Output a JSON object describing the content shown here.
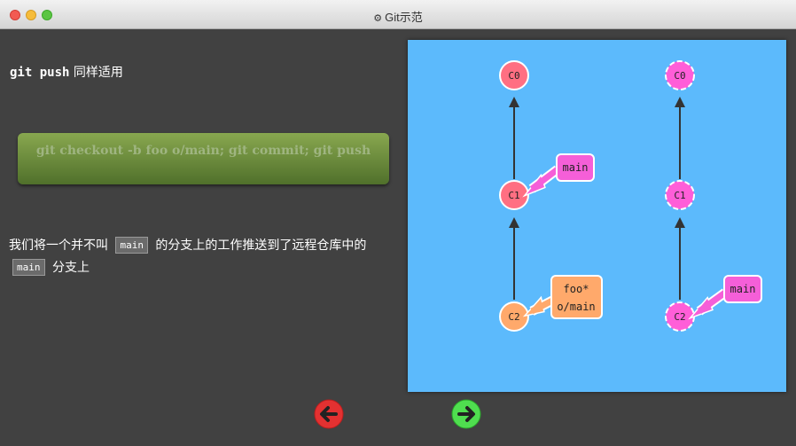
{
  "window": {
    "title": "Git示范",
    "title_icon": "gear-icon"
  },
  "lesson": {
    "heading_code": "git push",
    "heading_text": "同样适用",
    "command": "git checkout -b foo o/main; git commit; git push",
    "desc_part1": "我们将一个并不叫",
    "desc_code1": "main",
    "desc_part2": "的分支上的工作推送到了远程仓库中的",
    "desc_code2": "main",
    "desc_part3": "分支上"
  },
  "graph": {
    "local": {
      "commits": [
        "C0",
        "C1",
        "C2"
      ],
      "branches": [
        {
          "label": "main",
          "target": "C1"
        },
        {
          "label_lines": [
            "foo*",
            "o/main"
          ],
          "target": "C2"
        }
      ]
    },
    "remote": {
      "commits": [
        "C0",
        "C1",
        "C2"
      ],
      "branches": [
        {
          "label": "main",
          "target": "C2"
        }
      ]
    }
  },
  "colors": {
    "background": "#414141",
    "panel": "#5cbafc",
    "local_commit": "#ff6f82",
    "remote_commit": "#ff5ed8",
    "main_branch": "#f55fd8",
    "foo_branch": "#ffa96b",
    "command_box": "#6b8a3c"
  },
  "nav": {
    "back_icon": "left-arrow-icon",
    "next_icon": "right-arrow-icon"
  }
}
